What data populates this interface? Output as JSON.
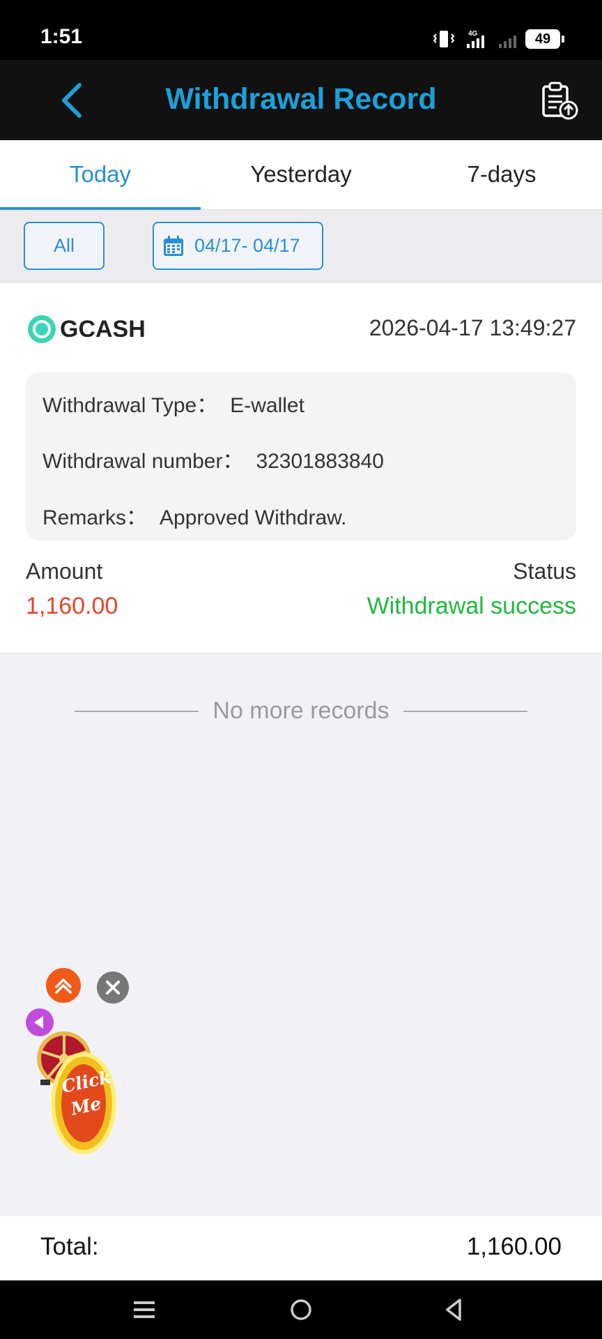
{
  "status_bar": {
    "time": "1:51",
    "network": "4G",
    "battery": "49"
  },
  "header": {
    "title": "Withdrawal Record",
    "back_icon": "chevron-left-icon",
    "action_icon": "clipboard-upload-icon"
  },
  "tabs": [
    {
      "label": "Today",
      "active": true
    },
    {
      "label": "Yesterday",
      "active": false
    },
    {
      "label": "7-days",
      "active": false
    }
  ],
  "filters": {
    "type_label": "All",
    "date_range": "04/17- 04/17",
    "date_icon": "calendar-icon"
  },
  "record": {
    "method": "GCASH",
    "datetime": "2026-04-17 13:49:27",
    "type_label": "Withdrawal Type：",
    "type_value": "E-wallet",
    "number_label": "Withdrawal number：",
    "number_value": "32301883840",
    "remarks_label": "Remarks：",
    "remarks_value": "Approved Withdraw.",
    "amount_label": "Amount",
    "amount_value": "1,160.00",
    "status_label": "Status",
    "status_value": "Withdrawal success"
  },
  "list_end": "No more records",
  "floating": {
    "promo_text": "Click Me"
  },
  "total": {
    "label": "Total:",
    "value": "1,160.00"
  },
  "colors": {
    "accent": "#2a8fd0",
    "title": "#1da0d8",
    "amount": "#e2452b",
    "success": "#21b83c"
  }
}
